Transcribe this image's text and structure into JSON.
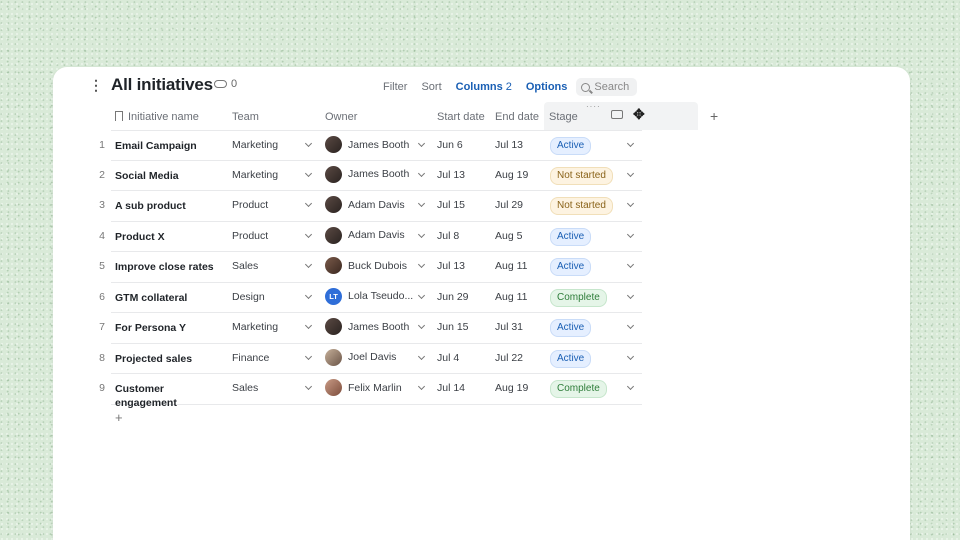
{
  "header": {
    "title": "All initiatives",
    "link_count": "0",
    "toolbar": {
      "filter": "Filter",
      "sort": "Sort",
      "columns": "Columns",
      "columns_count": "2",
      "options": "Options",
      "search_placeholder": "Search"
    }
  },
  "table": {
    "columns": {
      "name": "Initiative name",
      "team": "Team",
      "owner": "Owner",
      "start": "Start date",
      "end": "End date",
      "stage": "Stage"
    },
    "rows": [
      {
        "num": "1",
        "name": "Email Campaign",
        "team": "Marketing",
        "owner": "James Booth",
        "owner_initials": "",
        "start": "Jun 6",
        "end": "Jul 13",
        "stage": "Active"
      },
      {
        "num": "2",
        "name": "Social Media",
        "team": "Marketing",
        "owner": "James Booth",
        "owner_initials": "",
        "start": "Jul 13",
        "end": "Aug 19",
        "stage": "Not started"
      },
      {
        "num": "3",
        "name": "A sub product",
        "team": "Product",
        "owner": "Adam Davis",
        "owner_initials": "",
        "start": "Jul 15",
        "end": "Jul 29",
        "stage": "Not started"
      },
      {
        "num": "4",
        "name": "Product X",
        "team": "Product",
        "owner": "Adam Davis",
        "owner_initials": "",
        "start": "Jul 8",
        "end": "Aug 5",
        "stage": "Active"
      },
      {
        "num": "5",
        "name": "Improve close rates",
        "team": "Sales",
        "owner": "Buck Dubois",
        "owner_initials": "",
        "start": "Jul 13",
        "end": "Aug 11",
        "stage": "Active"
      },
      {
        "num": "6",
        "name": "GTM collateral",
        "team": "Design",
        "owner": "Lola Tseudo...",
        "owner_initials": "LT",
        "start": "Jun 29",
        "end": "Aug 11",
        "stage": "Complete"
      },
      {
        "num": "7",
        "name": "For Persona Y",
        "team": "Marketing",
        "owner": "James Booth",
        "owner_initials": "",
        "start": "Jun 15",
        "end": "Jul 31",
        "stage": "Active"
      },
      {
        "num": "8",
        "name": "Projected sales",
        "team": "Finance",
        "owner": "Joel Davis",
        "owner_initials": "",
        "start": "Jul 4",
        "end": "Jul 22",
        "stage": "Active"
      },
      {
        "num": "9",
        "name": "Customer engagement",
        "team": "Sales",
        "owner": "Felix Marlin",
        "owner_initials": "",
        "start": "Jul 14",
        "end": "Aug 19",
        "stage": "Complete"
      }
    ]
  },
  "colors": {
    "accent": "#1a5fb4",
    "background": "#d9ead8",
    "active": "#e5efff",
    "not_started": "#fdf3e1",
    "complete": "#e5f5e8"
  }
}
